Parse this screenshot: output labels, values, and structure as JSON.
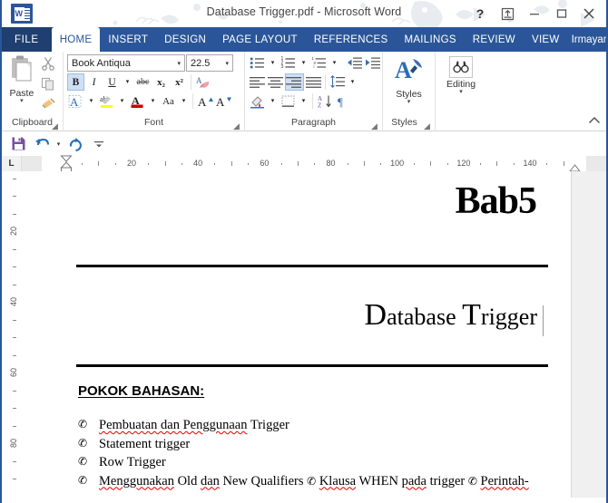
{
  "window": {
    "title": "Database Trigger.pdf - Microsoft Word",
    "help_label": "?",
    "ribbon_display_label": "ribbon-display-options",
    "minimize_label": "minimize",
    "restore_label": "restore",
    "close_label": "close"
  },
  "tabs": {
    "file": "FILE",
    "items": [
      {
        "label": "HOME",
        "active": true
      },
      {
        "label": "INSERT",
        "active": false
      },
      {
        "label": "DESIGN",
        "active": false
      },
      {
        "label": "PAGE LAYOUT",
        "active": false
      },
      {
        "label": "REFERENCES",
        "active": false
      },
      {
        "label": "MAILINGS",
        "active": false
      },
      {
        "label": "REVIEW",
        "active": false
      },
      {
        "label": "VIEW",
        "active": false
      }
    ],
    "user": "Irmayani...",
    "user_caret": "▾"
  },
  "ribbon": {
    "groups": {
      "clipboard": {
        "label": "Clipboard",
        "paste_label": "Paste",
        "caret": "▾"
      },
      "font": {
        "label": "Font",
        "font_name": "Book Antiqua",
        "font_size": "22.5",
        "caret": "▾",
        "bold": "B",
        "italic": "I",
        "underline": "U",
        "strikethrough": "abc",
        "subscript": "x₂",
        "superscript": "x²",
        "text_effects": "A",
        "highlight": "ab",
        "font_color": "A",
        "change_case": "Aa",
        "grow_font": "A",
        "shrink_font": "A",
        "clear_formatting": "A"
      },
      "paragraph": {
        "label": "Paragraph",
        "caret": "▾"
      },
      "styles": {
        "label": "Styles",
        "button_label": "Styles",
        "caret": "▾"
      },
      "editing": {
        "label": "Editing",
        "button_label": "Editing",
        "caret": "▾"
      }
    },
    "collapse_label": "^"
  },
  "quick_access": {
    "save": "save-icon",
    "undo": "undo-icon",
    "redo": "redo-icon",
    "customize": "customize-icon",
    "undo_caret": "▾",
    "customize_caret": "▾"
  },
  "ruler": {
    "tab_selector": "L",
    "horizontal_numbers": [
      "20",
      "40",
      "60",
      "80",
      "100",
      "120",
      "140"
    ],
    "vertical_numbers": [
      "20",
      "40",
      "60",
      "80"
    ]
  },
  "document": {
    "chapter_word": "Bab",
    "chapter_number": "5",
    "subtitle_parts": [
      {
        "cap": "D",
        "rest": "atabase"
      },
      {
        "cap": "T",
        "rest": "rigger"
      }
    ],
    "section_heading": "POKOK BAHASAN:",
    "bullet_glyph": "✆",
    "bullets": [
      {
        "parts": [
          {
            "text": "Pembuatan dan Penggunaan",
            "spell": true
          },
          {
            "text": " Trigger",
            "spell": false
          }
        ]
      },
      {
        "parts": [
          {
            "text": "Statement trigger",
            "spell": false
          }
        ]
      },
      {
        "parts": [
          {
            "text": "Row Trigger",
            "spell": false
          }
        ]
      },
      {
        "parts": [
          {
            "text": "Menggunakan",
            "spell": true
          },
          {
            "text": " Old ",
            "spell": false
          },
          {
            "text": "dan",
            "spell": true
          },
          {
            "text": " New  Qualifiers  ",
            "spell": false
          },
          {
            "text": "✆",
            "spell": false,
            "glyph": true
          },
          {
            "text": "  ",
            "spell": false
          },
          {
            "text": "Klausa",
            "spell": true
          },
          {
            "text": " WHEN ",
            "spell": false
          },
          {
            "text": "pada",
            "spell": true
          },
          {
            "text": " trigger  ",
            "spell": false
          },
          {
            "text": "✆",
            "spell": false,
            "glyph": true
          },
          {
            "text": "  ",
            "spell": false
          },
          {
            "text": "Perintah-",
            "spell": true
          }
        ]
      }
    ]
  },
  "colors": {
    "accent": "#2a5699",
    "file_tab": "#1e3f6f",
    "active_tab_text": "#2a5699",
    "spell_error": "#e00000",
    "toggle_on": "#cfe0f4"
  }
}
